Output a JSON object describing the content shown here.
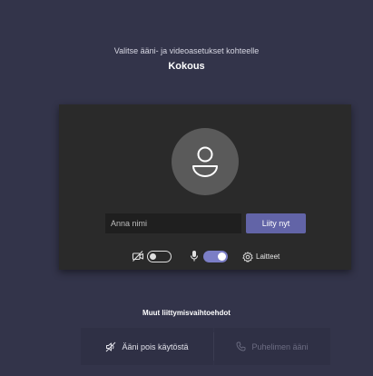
{
  "header": {
    "subtitle": "Valitse ääni- ja videoasetukset kohteelle",
    "title": "Kokous"
  },
  "prejoin": {
    "name_input": {
      "value": "",
      "placeholder": "Anna nimi"
    },
    "join_button_label": "Liity nyt",
    "camera_toggle": {
      "state": "off",
      "icon": "camera-off-icon"
    },
    "mic_toggle": {
      "state": "on",
      "icon": "microphone-icon"
    },
    "devices_label": "Laitteet",
    "devices_icon": "gear-icon"
  },
  "other_options": {
    "heading": "Muut liittymisvaihtoehdot",
    "audio_off_label": "Ääni pois käytöstä",
    "audio_off_icon": "speaker-off-icon",
    "phone_audio_label": "Puhelimen ääni",
    "phone_audio_icon": "phone-icon",
    "phone_audio_enabled": false
  },
  "colors": {
    "background": "#33344a",
    "panel": "#2a2a2a",
    "accent": "#6264a7",
    "toggle_on": "#7b7ec6"
  }
}
